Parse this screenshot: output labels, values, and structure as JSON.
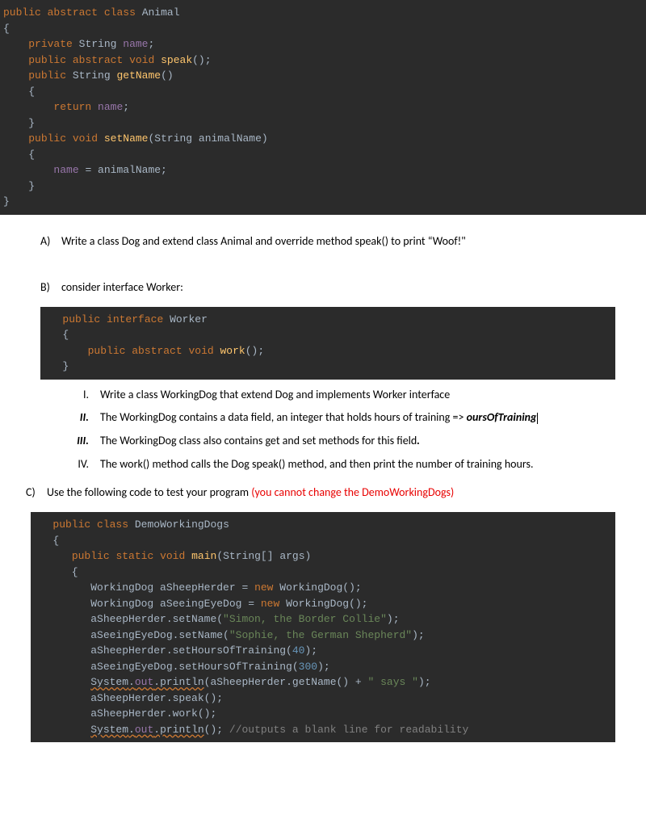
{
  "code1": {
    "l1_kw1": "public",
    "l1_kw2": "abstract",
    "l1_kw3": "class",
    "l1_name": "Animal",
    "l2": "{",
    "l3_kw": "private",
    "l3_type": "String",
    "l3_field": "name",
    "l3_semi": ";",
    "l4_kw1": "public",
    "l4_kw2": "abstract",
    "l4_kw3": "void",
    "l4_m": "speak",
    "l4_p": "();",
    "l5_kw": "public",
    "l5_type": "String",
    "l5_m": "getName",
    "l5_p": "()",
    "l6": "    {",
    "l7_kw": "return",
    "l7_field": "name",
    "l7_semi": ";",
    "l8": "    }",
    "l9_kw1": "public",
    "l9_kw2": "void",
    "l9_m": "setName",
    "l9_p": "(String animalName)",
    "l10": "    {",
    "l11_f": "name",
    "l11_eq": " = animalName;",
    "l12": "    }",
    "l13": "}"
  },
  "qA": {
    "label": "A)",
    "text": "Write a class Dog and extend class Animal and override method speak() to print “Woof!\""
  },
  "qB": {
    "label": "B)",
    "text": "consider interface Worker:"
  },
  "code2": {
    "l1_kw1": "public",
    "l1_kw2": "interface",
    "l1_name": "Worker",
    "l2": "   {",
    "l3_kw1": "public",
    "l3_kw2": "abstract",
    "l3_kw3": "void",
    "l3_m": "work",
    "l3_p": "();",
    "l4": "   }"
  },
  "roman": {
    "i": {
      "label": "I.",
      "text": "Write a class WorkingDog that extend Dog and implements Worker interface"
    },
    "ii": {
      "label": "II.",
      "pre": "The  WorkingDog contains a data field, an integer that holds hours of training => ",
      "em": "oursOfTraining"
    },
    "iii": {
      "label": "III.",
      "pre": "The WorkingDog class also contains get and set methods for this field",
      "dot": "."
    },
    "iv": {
      "label": "IV.",
      "text": "The work() method calls the Dog speak() method, and then print the number of training hours."
    }
  },
  "qC": {
    "label": "C)",
    "text": "Use the following code to test your program ",
    "warn": "(you cannot change the DemoWorkingDogs)"
  },
  "code3": {
    "l1_kw1": "public",
    "l1_kw2": "class",
    "l1_name": "DemoWorkingDogs",
    "l2": "   {",
    "l3_kw1": "public",
    "l3_kw2": "static",
    "l3_kw3": "void",
    "l3_m": "main",
    "l3_p": "(String[] args)",
    "l4": "      {",
    "l5a": "WorkingDog aSheepHerder = ",
    "l5_kw": "new",
    "l5b": " WorkingDog();",
    "l6a": "WorkingDog aSeeingEyeDog = ",
    "l6_kw": "new",
    "l6b": " WorkingDog();",
    "l7a": "aSheepHerder.setName(",
    "l7s": "\"Simon, the Border Collie\"",
    "l7b": ");",
    "l8a": "aSeeingEyeDog.setName(",
    "l8s": "\"Sophie, the German Shepherd\"",
    "l8b": ");",
    "l9a": "aSheepHerder.setHoursOfTraining(",
    "l9n": "40",
    "l9b": ");",
    "l10a": "aSeeingEyeDog.setHoursOfTraining(",
    "l10n": "300",
    "l10b": ");",
    "l11sys": "System",
    "l11dot1": ".",
    "l11out": "out",
    "l11dot2": ".",
    "l11pr": "println",
    "l11p": "(aSheepHerder.getName() + ",
    "l11s": "\" says \"",
    "l11e": ");",
    "l12": "aSheepHerder.speak();",
    "l13": "aSheepHerder.work();",
    "l14sys": "System",
    "l14dot1": ".",
    "l14out": "out",
    "l14dot2": ".",
    "l14pr": "println",
    "l14p": "(); ",
    "l14c": "//outputs a blank line for readability"
  }
}
